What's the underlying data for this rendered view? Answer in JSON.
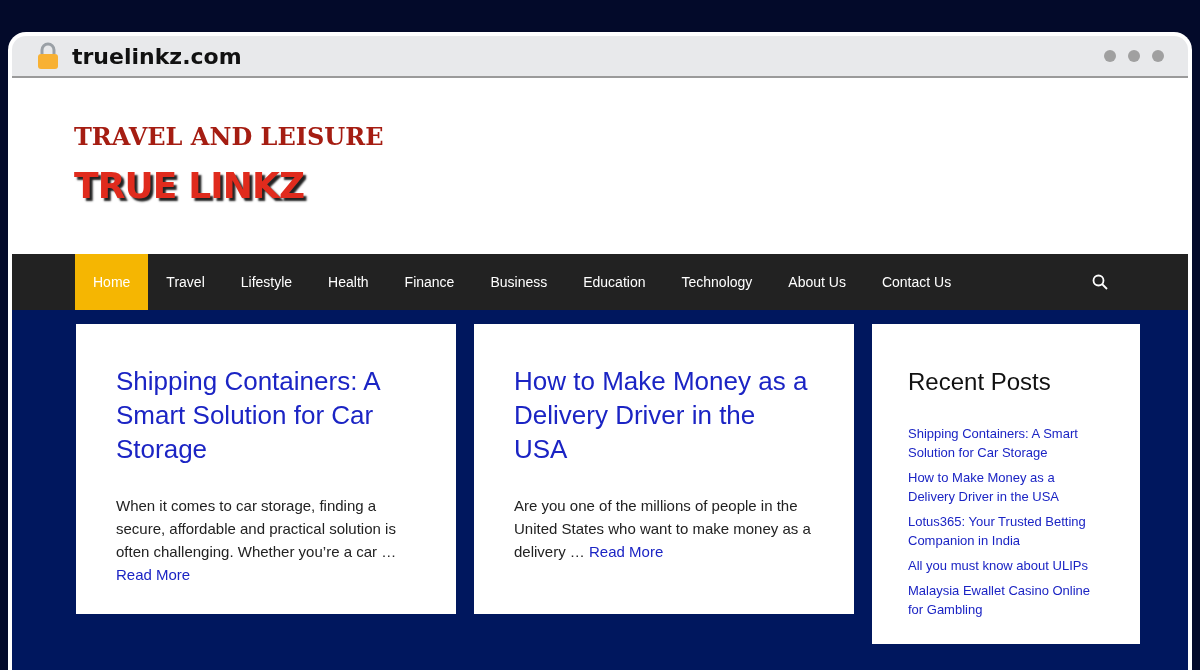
{
  "browser": {
    "url": "truelinkz.com"
  },
  "header": {
    "tagline": "TRAVEL AND LEISURE",
    "logo": "TRUE LINKZ"
  },
  "nav": {
    "items": [
      {
        "label": "Home",
        "selected": true
      },
      {
        "label": "Travel",
        "selected": false
      },
      {
        "label": "Lifestyle",
        "selected": false
      },
      {
        "label": "Health",
        "selected": false
      },
      {
        "label": "Finance",
        "selected": false
      },
      {
        "label": "Business",
        "selected": false
      },
      {
        "label": "Education",
        "selected": false
      },
      {
        "label": "Technology",
        "selected": false
      },
      {
        "label": "About Us",
        "selected": false
      },
      {
        "label": "Contact Us",
        "selected": false
      }
    ]
  },
  "posts": [
    {
      "title": "Shipping Containers: A Smart Solution for Car Storage",
      "excerpt": "When it comes to car storage, finding a secure, affordable and practical solution is often challenging. Whether you’re a car …",
      "read_more": "Read More"
    },
    {
      "title": "How to Make Money as a Delivery Driver in the USA",
      "excerpt": "Are you one of the millions of people in the United States who want to make money as a delivery …",
      "read_more": "Read More"
    }
  ],
  "sidebar": {
    "title": "Recent Posts",
    "items": [
      "Shipping Containers: A Smart Solution for Car Storage",
      "How to Make Money as a Delivery Driver in the USA",
      "Lotus365: Your Trusted Betting Companion in India",
      "All you must know about ULIPs",
      "Malaysia Ewallet Casino Online for Gambling"
    ]
  }
}
